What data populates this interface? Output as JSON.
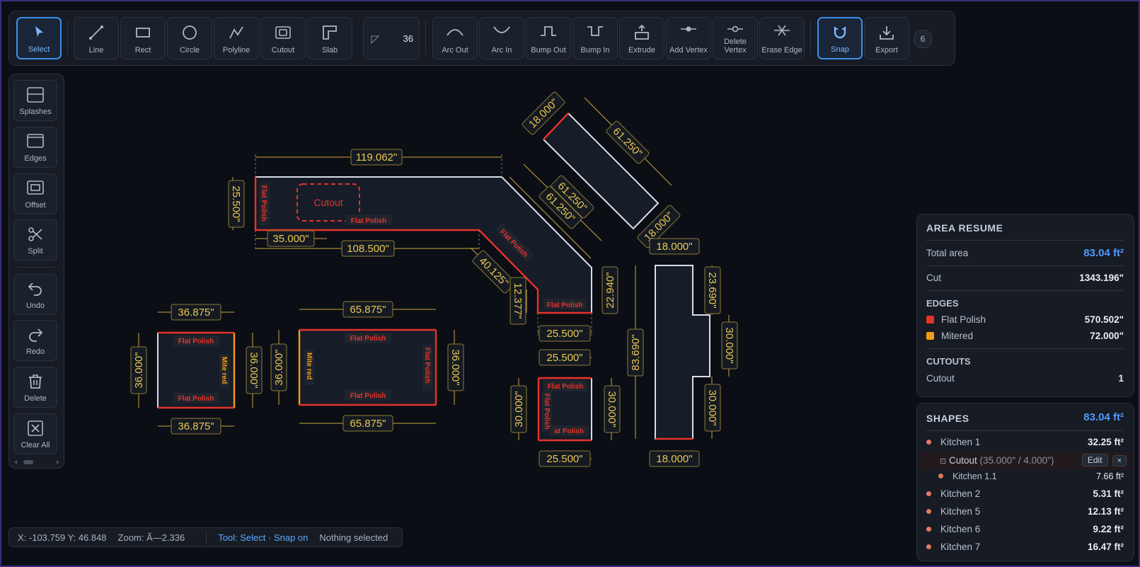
{
  "toolbar": {
    "tools": [
      {
        "label": "Select",
        "icon": "cursor-icon"
      },
      {
        "label": "Line",
        "icon": "line-icon"
      },
      {
        "label": "Rect",
        "icon": "rect-icon"
      },
      {
        "label": "Circle",
        "icon": "circle-icon"
      },
      {
        "label": "Polyline",
        "icon": "polyline-icon"
      },
      {
        "label": "Cutout",
        "icon": "cutout-icon"
      },
      {
        "label": "Slab",
        "icon": "slab-icon"
      },
      {
        "label": "Arc Out",
        "icon": "arc-out-icon"
      },
      {
        "label": "Arc In",
        "icon": "arc-in-icon"
      },
      {
        "label": "Bump Out",
        "icon": "bump-out-icon"
      },
      {
        "label": "Bump In",
        "icon": "bump-in-icon"
      },
      {
        "label": "Extrude",
        "icon": "extrude-icon"
      },
      {
        "label": "Add Vertex",
        "icon": "add-vertex-icon"
      },
      {
        "label": "Delete Vertex",
        "icon": "delete-vertex-icon"
      },
      {
        "label": "Erase Edge",
        "icon": "erase-edge-icon"
      },
      {
        "label": "Snap",
        "icon": "magnet-icon"
      },
      {
        "label": "Export",
        "icon": "download-icon"
      }
    ],
    "angle_value": "36",
    "badge": "6",
    "active_tool": "Select",
    "snap_active": true
  },
  "sidebar": {
    "items": [
      {
        "label": "Splashes",
        "icon": "splashes-icon"
      },
      {
        "label": "Edges",
        "icon": "edges-icon"
      },
      {
        "label": "Offset",
        "icon": "offset-icon"
      },
      {
        "label": "Split",
        "icon": "scissors-icon"
      },
      {
        "label": "Undo",
        "icon": "undo-icon"
      },
      {
        "label": "Redo",
        "icon": "redo-icon"
      },
      {
        "label": "Delete",
        "icon": "trash-icon"
      },
      {
        "label": "Clear All",
        "icon": "clear-all-icon"
      }
    ]
  },
  "canvas": {
    "dims": {
      "k1_top": "119.062\"",
      "k1_left": "25.500\"",
      "k1_cut_off": "35.000\"",
      "k1_bottom": "108.500\"",
      "k1_diag_outer_a": "61.250\"",
      "k1_diag_outer_b": "61.250\"",
      "k1_diag_inner": "40.125\"",
      "k1_end_left": "12.377\"",
      "k1_end_right": "22.940\"",
      "k1_end_bottom": "25.500\"",
      "k11_short_a": "18.000\"",
      "k11_long": "61.250\"",
      "k11_short_b": "18.000\"",
      "k2_top": "36.875\"",
      "k2_bottom": "36.875\"",
      "k2_left": "36.000\"",
      "k2_right": "36.000\"",
      "k5_top": "65.875\"",
      "k5_bottom": "65.875\"",
      "k5_left": "36.000\"",
      "k5_right": "36.000\"",
      "k6_top": "25.500\"",
      "k6_bottom": "25.500\"",
      "k6_left": "30.000\"",
      "k6_right": "30.000\"",
      "k7_top": "18.000\"",
      "k7_bottom": "18.000\"",
      "k7_left": "83.690\"",
      "k7_r1": "23.690\"",
      "k7_r2": "30.000\"",
      "k7_r3": "30.000\""
    },
    "labels": {
      "cutout": "Cutout",
      "flat_polish": "Flat Polish",
      "flat_polish_short": "at Polish",
      "mitered": "Mitered",
      "mitered_split": "Mite red"
    },
    "colors": {
      "flat_polish": "#e5332a",
      "mitered": "#f39c12",
      "dimension": "#e8c24a",
      "shape_fill": "#161c28",
      "edge_default": "#d9dee6"
    }
  },
  "status": {
    "coords": "X: -103.759 Y: 46.848",
    "zoom": "Zoom: Ã—2.336",
    "tool": "Tool: Select · Snap on",
    "selection": "Nothing selected"
  },
  "area_panel": {
    "title": "AREA RESUME",
    "total_label": "Total area",
    "total_value": "83.04 ft²",
    "cut_label": "Cut",
    "cut_value": "1343.196\"",
    "edges_title": "EDGES",
    "edges": [
      {
        "label": "Flat Polish",
        "value": "570.502\"",
        "color": "#e5332a"
      },
      {
        "label": "Mitered",
        "value": "72.000\"",
        "color": "#f39c12"
      }
    ],
    "cutouts_title": "CUTOUTS",
    "cutouts": [
      {
        "label": "Cutout",
        "value": "1"
      }
    ]
  },
  "shapes_panel": {
    "title": "SHAPES",
    "total": "83.04 ft²",
    "items": [
      {
        "label": "Kitchen 1",
        "value": "32.25 ft²"
      },
      {
        "label": "Kitchen 1.1",
        "value": "7.66 ft²"
      },
      {
        "label": "Kitchen 2",
        "value": "5.31 ft²"
      },
      {
        "label": "Kitchen 5",
        "value": "12.13 ft²"
      },
      {
        "label": "Kitchen 6",
        "value": "9.22 ft²"
      },
      {
        "label": "Kitchen 7",
        "value": "16.47 ft²"
      }
    ],
    "cutout_row": {
      "label": "Cutout",
      "detail": "(35.000\" / 4.000\")",
      "edit": "Edit",
      "close": "×"
    }
  }
}
